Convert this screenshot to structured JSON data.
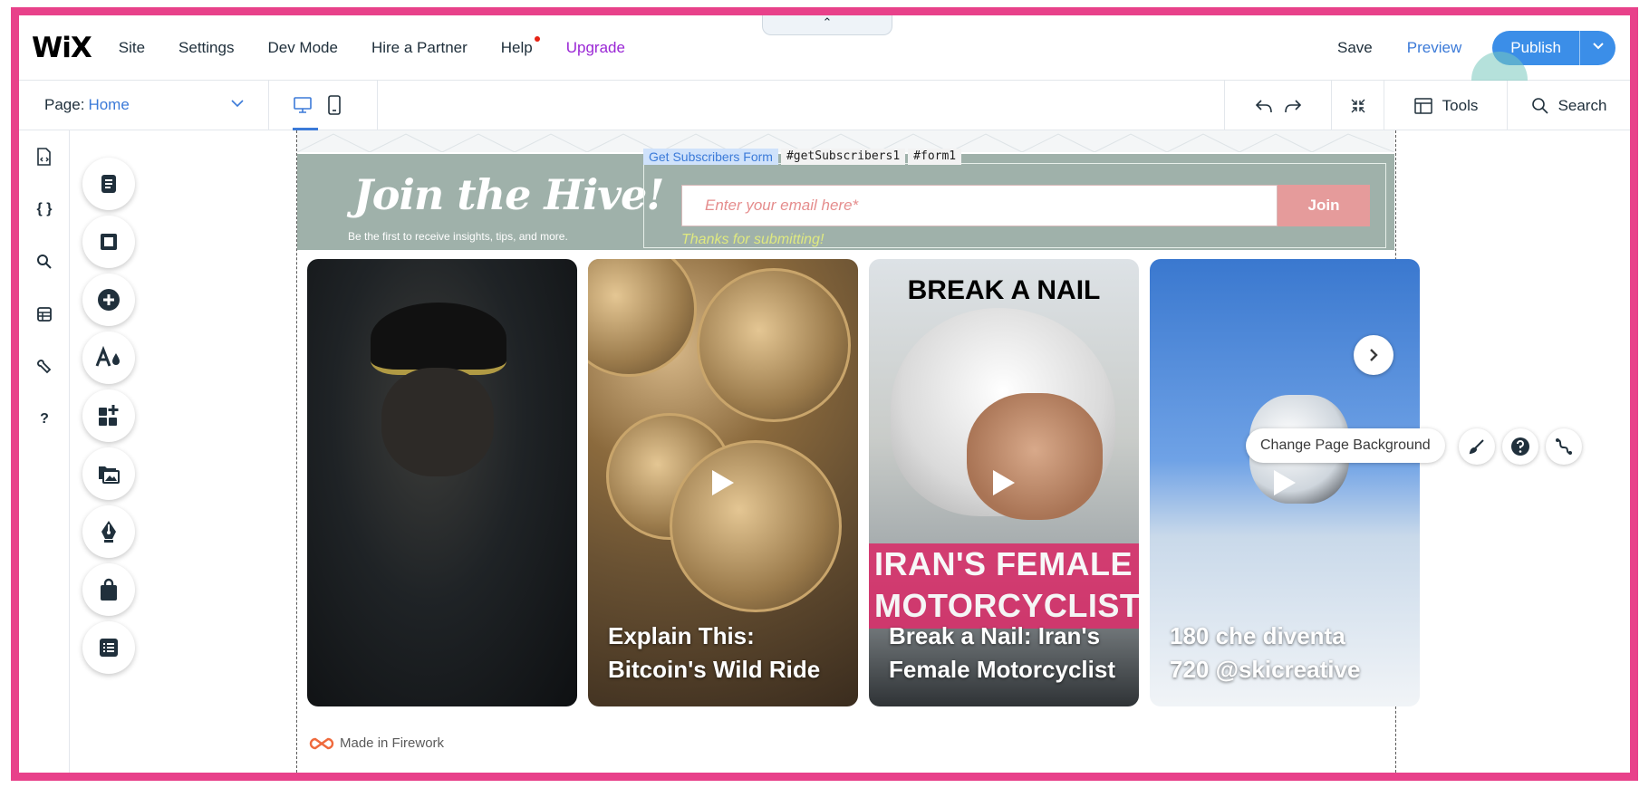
{
  "topbar": {
    "logo": "WiX",
    "menu": {
      "site": "Site",
      "settings": "Settings",
      "dev_mode": "Dev Mode",
      "hire_partner": "Hire a Partner",
      "help": "Help",
      "upgrade": "Upgrade"
    },
    "collapse_glyph": "⌃",
    "save": "Save",
    "preview": "Preview",
    "publish": "Publish"
  },
  "subbar": {
    "page_label": "Page:",
    "page_value": "Home",
    "tools": "Tools",
    "search": "Search"
  },
  "left_rail_icons": [
    "page-code-icon",
    "code-braces-icon",
    "search-icon",
    "database-icon",
    "wrench-icon",
    "help-icon"
  ],
  "left_rail_text": {
    "braces": "{ }",
    "question": "?"
  },
  "add_panel_icons": [
    "pages-icon",
    "section-icon",
    "add-elements-icon",
    "design-icon",
    "app-market-icon",
    "media-icon",
    "blog-icon",
    "store-icon",
    "cms-icon"
  ],
  "form_strip": {
    "title": "Join the Hive!",
    "subtitle": "Be the first to receive insights, tips, and more.",
    "selection_label": "Get Subscribers Form",
    "id1": "#getSubscribers1",
    "id2": "#form1",
    "email_placeholder": "Enter your email here*",
    "join": "Join",
    "thanks": "Thanks for submitting!"
  },
  "cards": [
    {
      "caption_line1": "",
      "caption_line2": ""
    },
    {
      "caption_line1": "Explain This:",
      "caption_line2": "Bitcoin's Wild Ride"
    },
    {
      "top_label": "BREAK A NAIL",
      "band_line1": "IRAN'S FEMALE",
      "band_line2": "MOTORCYCLIST",
      "caption_line1": "Break a Nail: Iran's",
      "caption_line2": "Female Motorcyclist"
    },
    {
      "caption_line1": "180 che diventa",
      "caption_line2": "720 @skicreative"
    }
  ],
  "made_in": "Made in Firework",
  "floating": {
    "change_bg": "Change Page Background"
  },
  "colors": {
    "frame": "#e8418a",
    "accent": "#3b8ee8",
    "upgrade": "#9a27d5",
    "form_bg": "#9fb1aa",
    "join_btn": "#e59b9b",
    "band": "#d6336c"
  }
}
